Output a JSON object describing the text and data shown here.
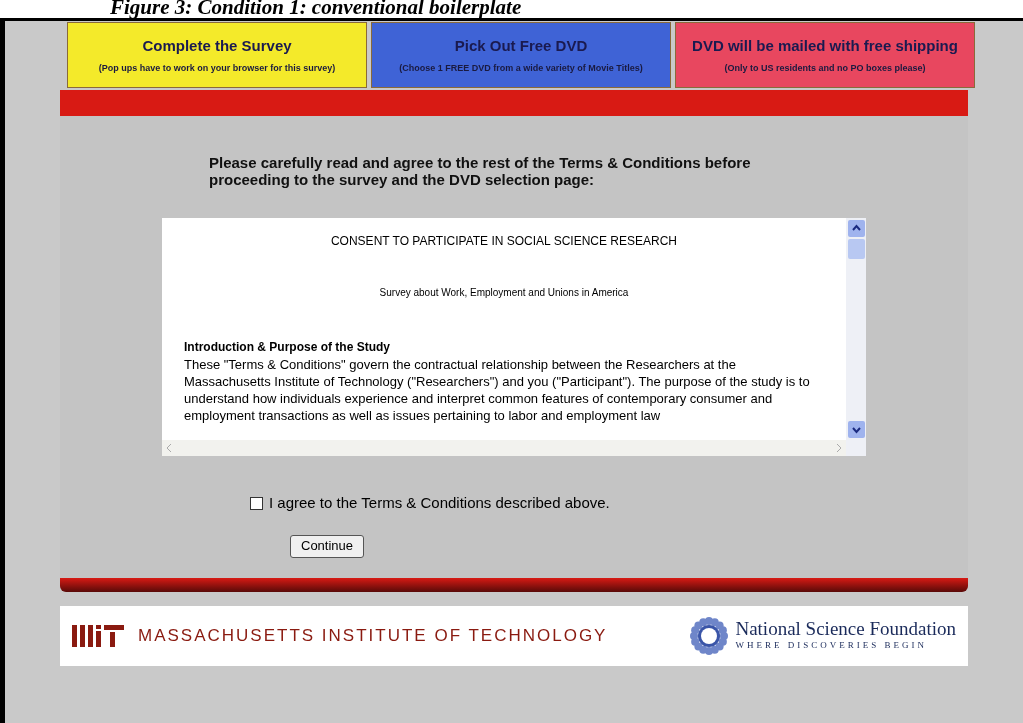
{
  "caption": "Figure 3: Condition 1: conventional boilerplate",
  "tabs": [
    {
      "title": "Complete the Survey",
      "subtitle": "(Pop ups have to work on your browser for this survey)",
      "color": "#f4ea2a"
    },
    {
      "title": "Pick Out Free DVD",
      "subtitle": "(Choose 1 FREE DVD from a wide variety of Movie Titles)",
      "color": "#3f63d6"
    },
    {
      "title": "DVD will be mailed with free shipping",
      "subtitle": "(Only to US residents and no PO boxes please)",
      "color": "#e8475f"
    }
  ],
  "instruction": "Please carefully read and agree to the rest of the Terms & Conditions before proceeding to the survey and the DVD selection page:",
  "terms": {
    "title": "CONSENT TO PARTICIPATE IN SOCIAL SCIENCE RESEARCH",
    "subtitle": "Survey about Work, Employment and Unions in America",
    "section_heading": "Introduction & Purpose of the Study",
    "paragraph": "These \"Terms & Conditions\" govern the contractual relationship between the Researchers at the Massachusetts Institute of Technology (\"Researchers\") and you (\"Participant\"). The purpose of the study is to understand how individuals experience and interpret common features of contemporary consumer and employment transactions as well as issues pertaining to labor and employment law"
  },
  "agree": {
    "label": "I agree to the Terms & Conditions described above.",
    "checked": false
  },
  "continue_button": "Continue",
  "footer": {
    "mit_name": "MASSACHUSETTS INSTITUTE OF TECHNOLOGY",
    "nsf_name": "National Science Foundation",
    "nsf_tagline": "WHERE DISCOVERIES BEGIN"
  }
}
